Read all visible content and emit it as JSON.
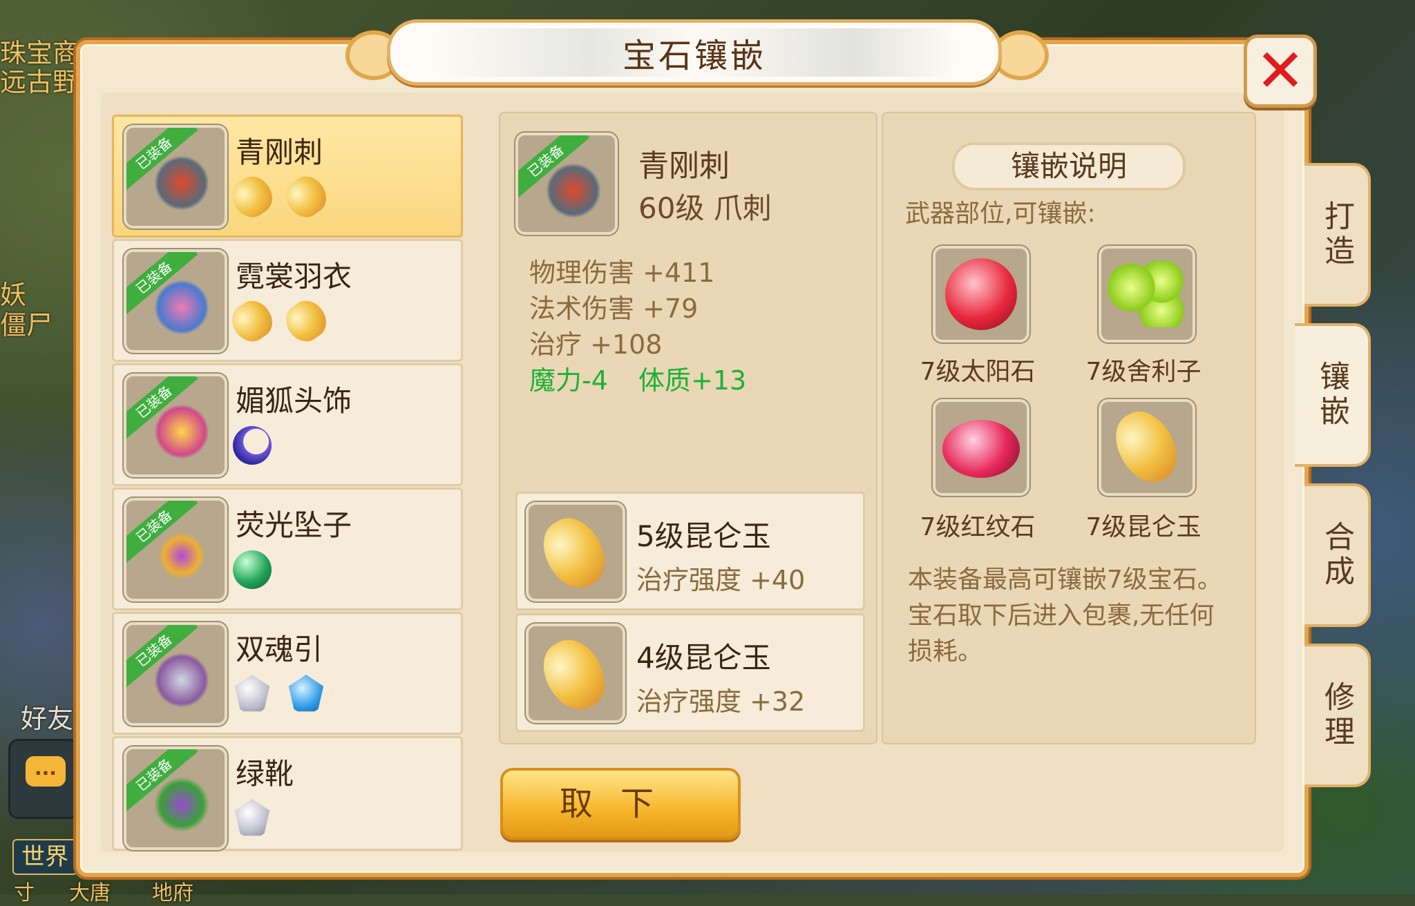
{
  "background": {
    "left_texts": [
      "珠宝商",
      "远古野",
      "妖",
      "僵尸",
      "好友"
    ],
    "world_chat": "世界",
    "bottom_texts": [
      "寸",
      "大唐",
      "地府"
    ],
    "chat_icon": "..."
  },
  "window": {
    "title": "宝石镶嵌",
    "close_icon": "close-x-icon"
  },
  "equipment_list": [
    {
      "name": "青刚刺",
      "badge": "已装备",
      "gems": [
        "yellow",
        "yellow"
      ],
      "selected": true
    },
    {
      "name": "霓裳羽衣",
      "badge": "已装备",
      "gems": [
        "yellow",
        "yellow"
      ],
      "selected": false
    },
    {
      "name": "媚狐头饰",
      "badge": "已装备",
      "gems": [
        "moon"
      ],
      "selected": false
    },
    {
      "name": "荧光坠子",
      "badge": "已装备",
      "gems": [
        "green"
      ],
      "selected": false
    },
    {
      "name": "双魂引",
      "badge": "已装备",
      "gems": [
        "white",
        "blue"
      ],
      "selected": false
    },
    {
      "name": "绿靴",
      "badge": "已装备",
      "gems": [
        "white"
      ],
      "selected": false
    }
  ],
  "detail": {
    "name": "青刚刺",
    "badge": "已装备",
    "level_type": "60级 爪刺",
    "stats": [
      {
        "label": "物理伤害 +411",
        "highlight": false
      },
      {
        "label": "法术伤害 +79",
        "highlight": false
      },
      {
        "label": "治疗 +108",
        "highlight": false
      }
    ],
    "bonus": [
      "魔力-4",
      "体质+13"
    ],
    "slots": [
      {
        "name": "5级昆仑玉",
        "stat": "治疗强度 +40"
      },
      {
        "name": "4级昆仑玉",
        "stat": "治疗强度 +32"
      }
    ],
    "remove_button": "取下"
  },
  "info": {
    "title": "镶嵌说明",
    "subtitle": "武器部位,可镶嵌:",
    "gems": [
      "7级太阳石",
      "7级舍利子",
      "7级红纹石",
      "7级昆仑玉"
    ],
    "note": "本装备最高可镶嵌7级宝石。宝石取下后进入包裹,无任何损耗。"
  },
  "side_tabs": [
    {
      "label": "打造",
      "active": false
    },
    {
      "label": "镶嵌",
      "active": true
    },
    {
      "label": "合成",
      "active": false
    },
    {
      "label": "修理",
      "active": false
    }
  ],
  "colors": {
    "panel_border": "#e4a54a",
    "selected_item": "#f9d77d",
    "bonus_green": "#1bb233",
    "close_red": "#e21c1c",
    "button_gold": "#f6b52a"
  }
}
